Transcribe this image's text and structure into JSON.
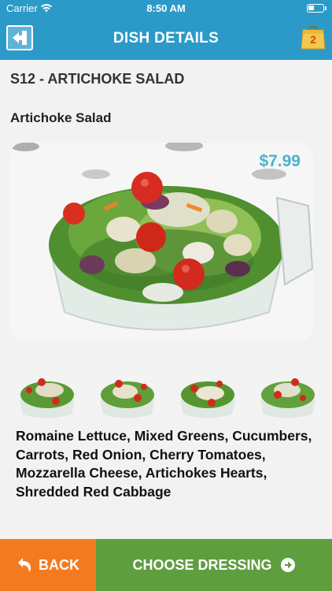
{
  "status_bar": {
    "carrier": "Carrier",
    "time": "8:50 AM"
  },
  "nav": {
    "title": "DISH DETAILS",
    "cart_count": "2"
  },
  "dish": {
    "code_title": "S12 - ARTICHOKE SALAD",
    "name": "Artichoke Salad",
    "price": "$7.99",
    "ingredients": "Romaine Lettuce, Mixed Greens, Cucumbers, Carrots, Red Onion, Cherry Tomatoes, Mozzarella Cheese, Artichokes Hearts, Shredded Red Cabbage"
  },
  "footer": {
    "back_label": "BACK",
    "choose_label": "CHOOSE DRESSING"
  },
  "colors": {
    "nav_blue": "#2b9ac9",
    "back_orange": "#f47a1f",
    "choose_green": "#5f9e3f",
    "price_teal": "#4bb3c9"
  },
  "icons": [
    "wifi-icon",
    "battery-icon",
    "back-arrow-icon",
    "shopping-bag-icon",
    "undo-arrow-icon",
    "arrow-circle-right-icon"
  ]
}
